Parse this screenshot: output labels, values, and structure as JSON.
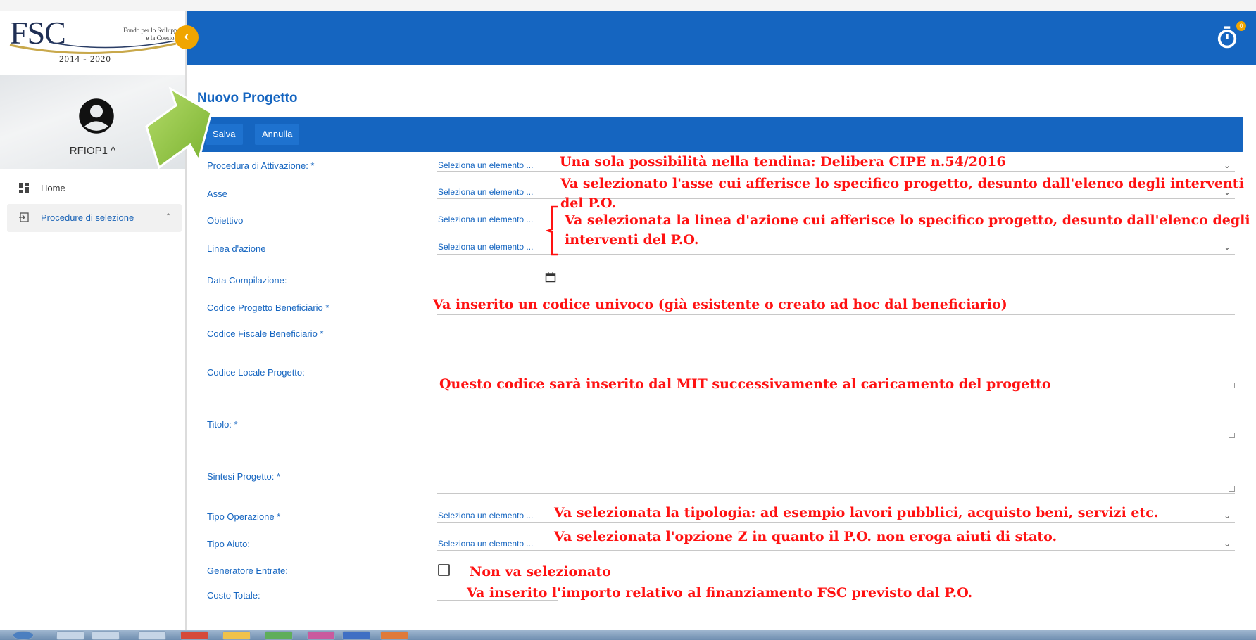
{
  "browser": {
    "strip_text": ""
  },
  "logo": {
    "mark": "FSC",
    "subtitle_line1": "Fondo per lo Sviluppo",
    "subtitle_line2": "e la Coesione",
    "years": "2014 - 2020"
  },
  "sidebar": {
    "collapse_icon": "chevron-left-icon",
    "user": {
      "name": "RFIOP1",
      "toggle_icon": "chevron-up-icon"
    },
    "items": [
      {
        "label": "Home",
        "icon": "dashboard-icon"
      },
      {
        "label": "Procedure di selezione",
        "icon": "login-icon",
        "expanded": true
      }
    ]
  },
  "header": {
    "timer_icon": "stopwatch-icon",
    "badge": "0",
    "color": "#1565c0"
  },
  "page": {
    "title": "Nuovo Progetto"
  },
  "toolbar": {
    "save_label": "Salva",
    "cancel_label": "Annulla"
  },
  "form": {
    "select_placeholder": "Seleziona un elemento ...",
    "fields": {
      "procedura": "Procedura di Attivazione: *",
      "asse": "Asse",
      "obiettivo": "Obiettivo",
      "linea": "Linea d'azione",
      "data": "Data Compilazione:",
      "codice_progetto": "Codice Progetto Beneficiario *",
      "codice_fiscale": "Codice Fiscale Beneficiario *",
      "codice_locale": "Codice Locale Progetto:",
      "titolo": "Titolo: *",
      "sintesi": "Sintesi Progetto: *",
      "tipo_operazione": "Tipo Operazione *",
      "tipo_aiuto": "Tipo Aiuto:",
      "generatore": "Generatore Entrate:",
      "costo": "Costo Totale:"
    }
  },
  "annotations": {
    "procedura": "Una sola possibilità nella tendina: Delibera CIPE n.54/2016",
    "asse_1": "Va selezionato l'asse cui afferisce lo specifico progetto, desunto dall'elenco degli interventi",
    "asse_2": "del P.O.",
    "linea_1": "Va selezionata la linea d'azione cui afferisce lo specifico progetto, desunto dall'elenco degli",
    "linea_2": "interventi  del P.O.",
    "codice_progetto": "Va inserito un codice univoco (già esistente o creato ad hoc dal beneficiario)",
    "codice_locale": "Questo codice sarà inserito dal MIT  successivamente al caricamento del progetto",
    "tipo_operazione": "Va  selezionata la tipologia: ad esempio lavori pubblici, acquisto beni, servizi etc.",
    "tipo_aiuto": "Va  selezionata l'opzione Z in quanto il P.O. non eroga aiuti di stato.",
    "generatore": "Non va selezionato",
    "costo": "Va inserito l'importo relativo al finanziamento FSC previsto dal P.O."
  },
  "colors": {
    "accent": "#1565c0",
    "annotation": "#ff1212",
    "badge": "#f0a500",
    "arrow": "#8dc63f"
  }
}
